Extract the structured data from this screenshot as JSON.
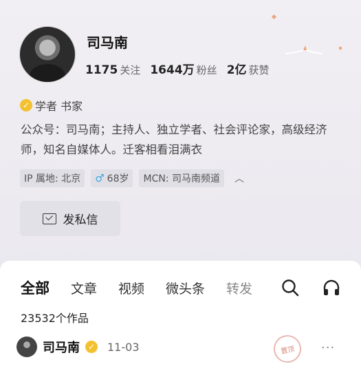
{
  "profile": {
    "name": "司马南",
    "stats": [
      {
        "value": "1175",
        "label": "关注"
      },
      {
        "value": "1644万",
        "label": "粉丝"
      },
      {
        "value": "2亿",
        "label": "获赞"
      }
    ],
    "verification": "学者 书家",
    "bio": "公众号：司马南；主持人、独立学者、社会评论家，高级经济师，知名自媒体人。迁客相看泪满衣",
    "tags": {
      "ip": "IP 属地: 北京",
      "gender_icon": "♂",
      "age": "68岁",
      "mcn": "MCN: 司马南频道"
    },
    "message_button": "发私信"
  },
  "content_tabs": [
    "全部",
    "文章",
    "视频",
    "微头条",
    "转发"
  ],
  "works_count": "23532个作品",
  "post": {
    "author": "司马南",
    "date": "11-03",
    "more": "···",
    "stamp_text": "置顶"
  },
  "icons": {
    "verify": "verified-badge-icon",
    "search": "search-icon",
    "headset": "headset-icon",
    "message": "message-icon"
  },
  "colors": {
    "verify_badge": "#f3c12f",
    "gender": "#3fa7e0"
  }
}
